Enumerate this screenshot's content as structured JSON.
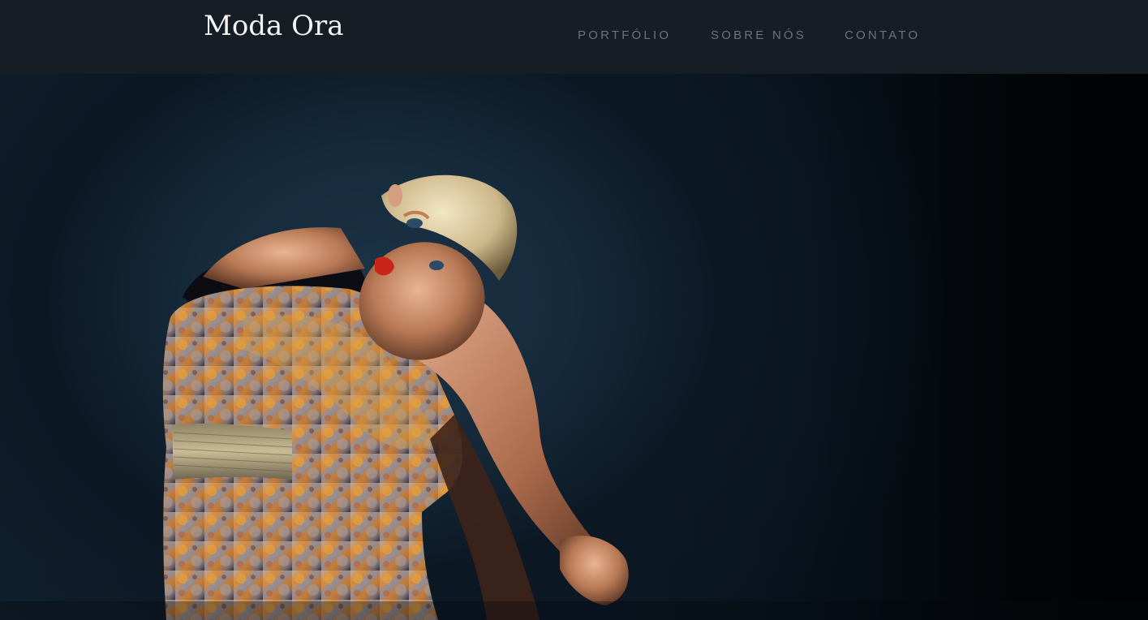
{
  "header": {
    "brand": "Moda Ora",
    "nav": [
      {
        "label": "PORTFÓLIO"
      },
      {
        "label": "SOBRE NÓS"
      },
      {
        "label": "CONTATO"
      }
    ]
  },
  "hero": {
    "image": "fashion-model-photo"
  },
  "colors": {
    "header_bg": "#161d25",
    "brand_text": "#f4f4f4",
    "nav_text": "#6b737a",
    "hero_bg": "#14293a"
  }
}
